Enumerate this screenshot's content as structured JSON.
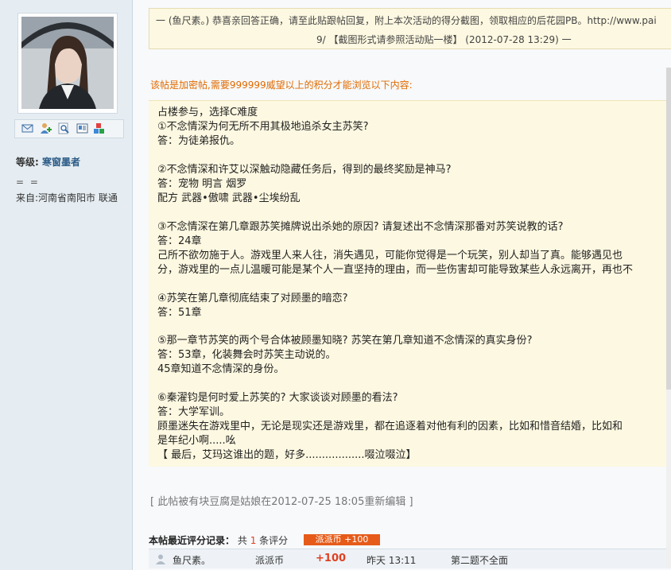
{
  "sidebar": {
    "level_label": "等级:",
    "level_value": "寒窗墨者",
    "separator": "= =",
    "from": "来自:河南省南阳市 联通",
    "icons": [
      "message-icon",
      "add-friend-icon",
      "search-icon",
      "profile-card-icon",
      "blocks-icon"
    ]
  },
  "quote": {
    "line1": "一 (鱼尺素。) 恭喜亲回答正确，请至此贴跟帖回复，附上本次活动的得分截图，领取相应的后花园PB。http://www.pai",
    "line2": "9/ 【截图形式请参照活动贴一楼】 (2012-07-28 13:29) 一"
  },
  "hidden_notice": "该帖是加密帖,需要999999威望以上的积分才能浏览以下内容:",
  "content": [
    "占楼参与，选择C难度",
    "①不念情深为何无所不用其极地追杀女主苏笑?",
    "答：为徒弟报仇。",
    "",
    "②不念情深和许艾以深触动隐藏任务后，得到的最终奖励是神马?",
    "答：宠物  明言  烟罗",
    "      配方  武器•傲啸  武器•尘埃纷乱",
    "",
    "③不念情深在第几章跟苏笑摊牌说出杀她的原因? 请复述出不念情深那番对苏笑说教的话?",
    "答：24章",
    "      己所不欲勿施于人。游戏里人来人往，消失遇见，可能你觉得是一个玩笑，别人却当了真。能够遇见也",
    "分，游戏里的一点儿温暖可能是某个人一直坚持的理由，而一些伤害却可能导致某些人永远离开，再也不",
    "",
    "④苏笑在第几章彻底结束了对顾墨的暗恋?",
    "答：51章",
    "",
    "⑤那一章节苏笑的两个号合体被顾墨知晓? 苏笑在第几章知道不念情深的真实身份?",
    "答：53章，化装舞会时苏笑主动说的。",
    "       45章知道不念情深的身份。",
    "",
    "⑥秦濯钧是何时爱上苏笑的? 大家谈谈对顾墨的看法?",
    "答：大学军训。",
    "    顾墨迷失在游戏里中，无论是现实还是游戏里，都在追逐着对他有利的因素，比如和惜音结婚，比如和",
    "是年纪小啊.....吆",
    "【  最后，艾玛这谁出的题，好多..................啜泣啜泣】"
  ],
  "edit_note": "[ 此帖被有块豆腐是姑娘在2012-07-25 18:05重新编辑 ]",
  "rating": {
    "title": "本帖最近评分记录：",
    "prefix": "共",
    "count": "1",
    "suffix": "条评分",
    "badge": "派派币 +100",
    "row": {
      "user": "鱼尺素。",
      "type": "派派币",
      "score": "+100",
      "time": "昨天 13:11",
      "reason": "第二题不全面"
    }
  },
  "colors": {
    "sidebar_bg": "#e5edf2",
    "quote_bg": "#fdf8e1",
    "notice": "#e06b00",
    "badge": "#e65b1a",
    "level_value": "#2b5a86"
  }
}
